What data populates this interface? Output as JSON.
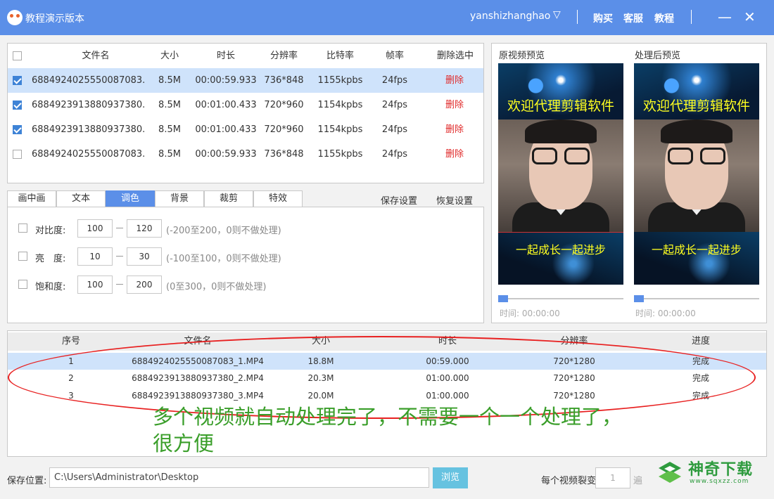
{
  "titlebar": {
    "app_title": "教程演示版本",
    "username": "yanshizhanghao",
    "user_chevron": "▽",
    "buy": "购买",
    "support": "客服",
    "tutorial": "教程",
    "minimize": "—",
    "close": "✕",
    "bg_color": "#5b8fe8"
  },
  "file_table": {
    "headers": [
      "文件名",
      "大小",
      "时长",
      "分辨率",
      "比特率",
      "帧率",
      "删除选中"
    ],
    "rows": [
      {
        "checked": true,
        "name": "6884924025550087083....",
        "size": "8.5M",
        "duration": "00:00:59.933",
        "resolution": "736*848",
        "bitrate": "1155kpbs",
        "fps": "24fps",
        "action": "删除"
      },
      {
        "checked": true,
        "name": "6884923913880937380....",
        "size": "8.5M",
        "duration": "00:01:00.433",
        "resolution": "720*960",
        "bitrate": "1154kpbs",
        "fps": "24fps",
        "action": "删除"
      },
      {
        "checked": true,
        "name": "6884923913880937380....",
        "size": "8.5M",
        "duration": "00:01:00.433",
        "resolution": "720*960",
        "bitrate": "1154kpbs",
        "fps": "24fps",
        "action": "删除"
      },
      {
        "checked": false,
        "name": "6884924025550087083....",
        "size": "8.5M",
        "duration": "00:00:59.933",
        "resolution": "736*848",
        "bitrate": "1155kpbs",
        "fps": "24fps",
        "action": "删除"
      }
    ]
  },
  "tabs": [
    "画中画",
    "文本",
    "调色",
    "背景",
    "裁剪",
    "特效"
  ],
  "active_tab": "调色",
  "tab_actions": {
    "save": "保存设置",
    "restore": "恢复设置"
  },
  "color_settings": [
    {
      "label": "对比度:",
      "min": "100",
      "max": "120",
      "hint": "(-200至200，0则不做处理)"
    },
    {
      "label": "亮　度:",
      "min": "10",
      "max": "30",
      "hint": "(-100至100，0则不做处理)"
    },
    {
      "label": "饱和度:",
      "min": "100",
      "max": "200",
      "hint": "(0至300，0则不做处理)"
    }
  ],
  "preview": {
    "original_title": "原视频预览",
    "processed_title": "处理后预览",
    "caption_top": "欢迎代理剪辑软件",
    "caption_bottom": "一起成长一起进步",
    "time_original": "时间:  00:00:00",
    "time_processed": "时间:  00:00:00"
  },
  "output_table": {
    "headers": [
      "序号",
      "文件名",
      "大小",
      "时长",
      "分辨率",
      "进度"
    ],
    "rows": [
      {
        "index": "1",
        "name": "6884924025550087083_1.MP4",
        "size": "18.8M",
        "duration": "00:59.000",
        "resolution": "720*1280",
        "progress": "完成"
      },
      {
        "index": "2",
        "name": "6884923913880937380_2.MP4",
        "size": "20.3M",
        "duration": "01:00.000",
        "resolution": "720*1280",
        "progress": "完成"
      },
      {
        "index": "3",
        "name": "6884923913880937380_3.MP4",
        "size": "20.0M",
        "duration": "01:00.000",
        "resolution": "720*1280",
        "progress": "完成"
      }
    ]
  },
  "annotation": {
    "line1": "多个视频就自动处理完了，不需要一个一个处理了，",
    "line2": "很方便"
  },
  "bottom": {
    "save_label": "保存位置:",
    "save_path": "C:\\Users\\Administrator\\Desktop",
    "browse": "浏览",
    "split_label": "每个视频裂变",
    "split_value": "1",
    "split_unit": "遍"
  },
  "watermark": {
    "brand": "神奇下载",
    "url": "www.sqxzz.com"
  }
}
